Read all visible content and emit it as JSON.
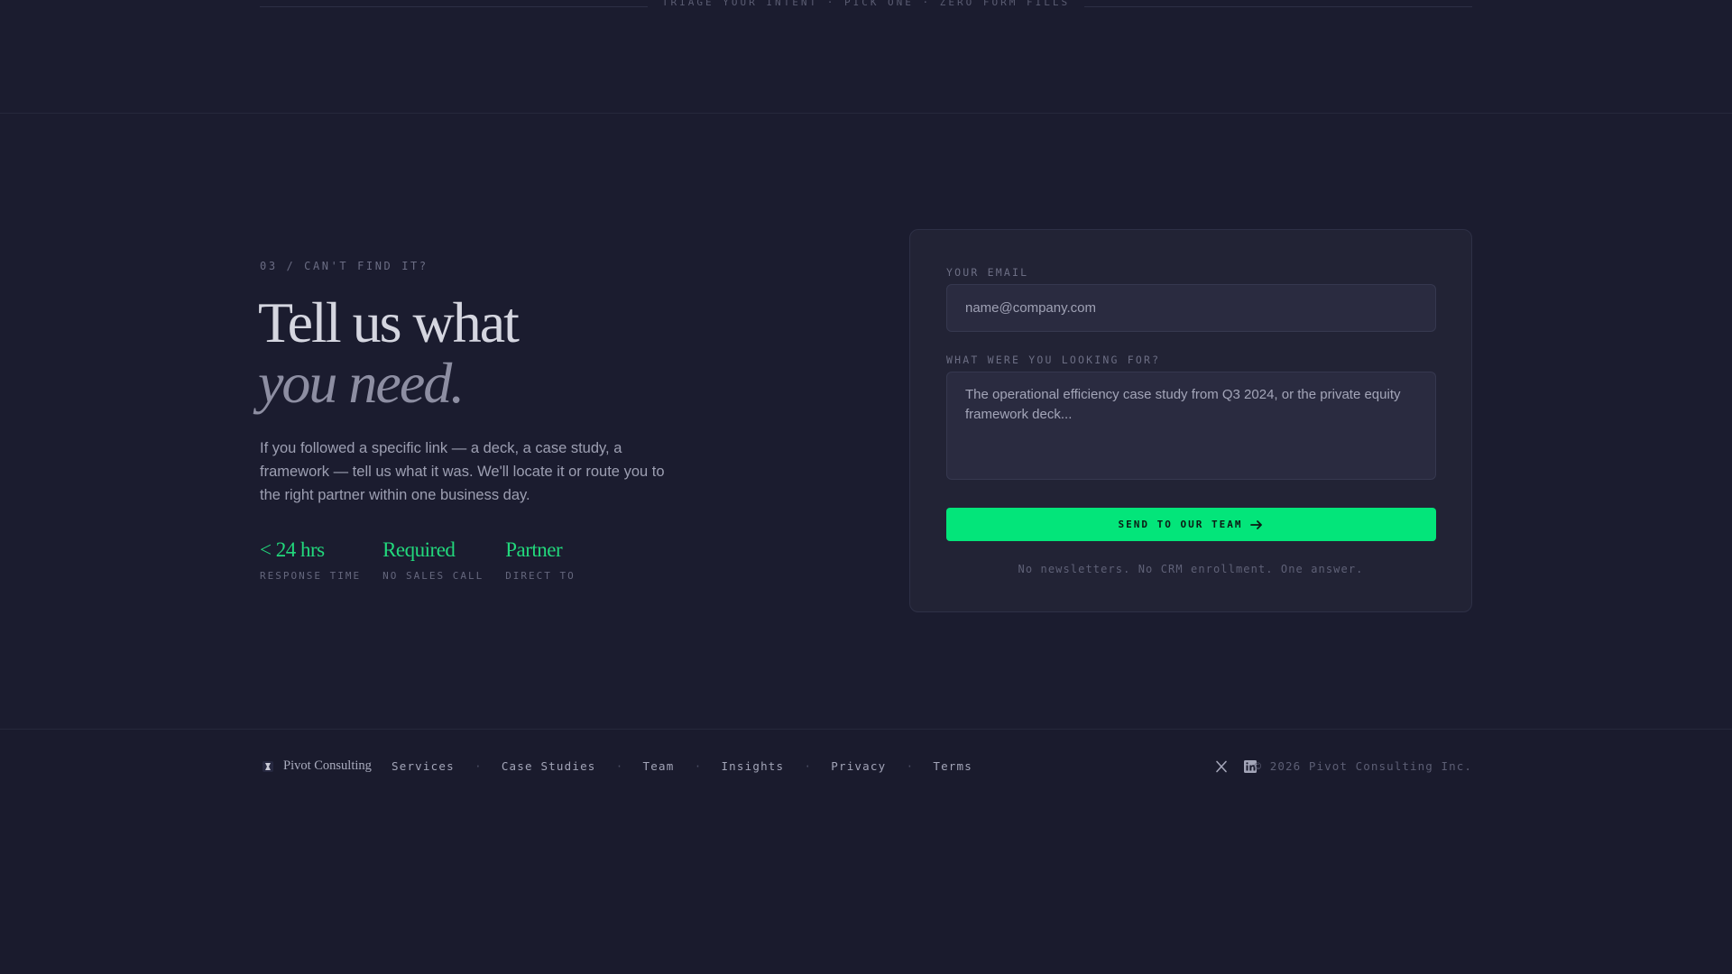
{
  "top_strip": {
    "label": "TRIAGE YOUR INTENT · PICK ONE · ZERO FORM FILLS"
  },
  "section": {
    "eyebrow": "03 / CAN'T FIND IT?",
    "headline_line1": "Tell us what",
    "headline_line2": "you need.",
    "intro": "If you followed a specific link — a deck, a case study, a framework — tell us what it was. We'll locate it or route you to the right partner within one business day.",
    "stats": [
      {
        "value": "< 24 hrs",
        "label": "RESPONSE TIME"
      },
      {
        "value": "Required",
        "label": "NO SALES CALL"
      },
      {
        "value": "Partner",
        "label": "DIRECT TO"
      }
    ]
  },
  "form": {
    "email_label": "YOUR EMAIL",
    "email_placeholder": "name@company.com",
    "query_label": "WHAT WERE YOU LOOKING FOR?",
    "query_placeholder": "The operational efficiency case study from Q3 2024, or the private equity framework deck...",
    "submit_label": "SEND TO OUR TEAM",
    "submit_icon": "arrow-right-icon",
    "fineprint": "No newsletters. No CRM enrollment. One answer."
  },
  "footer": {
    "brand": "Pivot Consulting",
    "nav": [
      "Services",
      "Case Studies",
      "Team",
      "Insights",
      "Privacy",
      "Terms"
    ],
    "separator": "·",
    "social": [
      "x-icon",
      "linkedin-icon"
    ],
    "copyright": "© 2026 Pivot Consulting Inc."
  },
  "colors": {
    "background": "#1b1c2f",
    "accent": "#03e57a",
    "card": "#222335"
  }
}
